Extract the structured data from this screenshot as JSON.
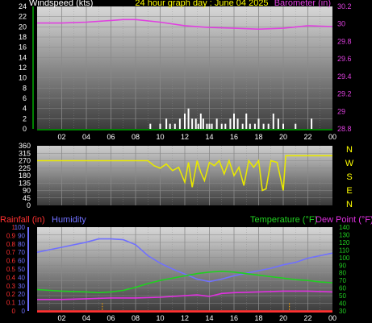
{
  "header": {
    "left_label": "Windspeed (kts)",
    "title": "24 hour graph day : June 04 2025",
    "right_label": "Barometer (in)"
  },
  "colors": {
    "bg_top": "#000000",
    "plot_bg_light": "#d8d8d8",
    "plot_bg_dark": "#3c3c3c",
    "pressure": "#e040e0",
    "wind_bars": "#ffffff",
    "wind_dir": "#e8e800",
    "humidity": "#7070ff",
    "temperature": "#20d020",
    "dewpoint": "#e030e0",
    "rain": "#ff3030",
    "title_yellow": "#ffff00",
    "axis_green": "#00ff00",
    "label_white": "#ffffff"
  },
  "time_axis": [
    "02",
    "04",
    "06",
    "08",
    "10",
    "12",
    "14",
    "16",
    "18",
    "20",
    "22",
    "00"
  ],
  "compass_labels": [
    "N",
    "W",
    "S",
    "E",
    "N"
  ],
  "panel3_labels": {
    "rain": "Rainfall (in)",
    "humidity": "Humidity",
    "temperature": "Temperature (°F)",
    "dewpoint": "Dew Point (°F)"
  },
  "chart_data": [
    {
      "type": "line",
      "title": "24 hour graph day : June 04 2025",
      "x_label": "",
      "ticks_x": [
        "02",
        "04",
        "06",
        "08",
        "10",
        "12",
        "14",
        "16",
        "18",
        "20",
        "22",
        "00"
      ],
      "left_axis": {
        "label": "Windspeed (kts)",
        "range": [
          0,
          24
        ],
        "ticks": [
          0,
          2,
          4,
          6,
          8,
          10,
          12,
          14,
          16,
          18,
          20,
          22,
          24
        ]
      },
      "right_axis": {
        "label": "Barometer (in)",
        "range": [
          28.8,
          30.2
        ],
        "ticks": [
          "28.8",
          "29",
          "29.2",
          "29.4",
          "29.6",
          "29.8",
          "30",
          "30.2"
        ]
      },
      "series": [
        {
          "name": "Barometer (in)",
          "axis": "right",
          "x": [
            0,
            2,
            4,
            6,
            7,
            8,
            10,
            12,
            14,
            16,
            18,
            20,
            22,
            24
          ],
          "y": [
            30.01,
            30.01,
            30.02,
            30.04,
            30.05,
            30.05,
            30.02,
            29.98,
            29.96,
            29.95,
            29.94,
            29.95,
            29.98,
            29.97
          ]
        },
        {
          "name": "Windspeed (kts)",
          "axis": "left",
          "kind": "bars",
          "x": [
            9.2,
            10.0,
            10.5,
            10.8,
            11.2,
            11.6,
            12.0,
            12.3,
            12.6,
            12.9,
            13.1,
            13.3,
            13.5,
            13.8,
            14.0,
            14.2,
            14.6,
            15.0,
            15.3,
            15.7,
            16.0,
            16.3,
            16.7,
            17.0,
            17.3,
            17.7,
            18.0,
            18.4,
            18.8,
            19.2,
            19.6,
            20.0,
            21.0,
            22.3
          ],
          "y": [
            1,
            1,
            2,
            1,
            1,
            2,
            3,
            4,
            2,
            2,
            1,
            3,
            2,
            1,
            1,
            1,
            2,
            1,
            1,
            2,
            3,
            2,
            1,
            3,
            1,
            1,
            2,
            1,
            1,
            3,
            2,
            1,
            1,
            2
          ]
        }
      ]
    },
    {
      "type": "line",
      "left_axis": {
        "range": [
          0,
          360
        ],
        "ticks": [
          0,
          45,
          90,
          135,
          180,
          225,
          270,
          315,
          360
        ]
      },
      "right_axis": {
        "labels": [
          "N",
          "W",
          "S",
          "E",
          "N"
        ]
      },
      "series": [
        {
          "name": "Wind direction",
          "axis": "left",
          "x": [
            0,
            9.0,
            9.5,
            10.0,
            10.5,
            11.0,
            11.5,
            12.0,
            12.3,
            12.6,
            13.0,
            13.3,
            13.6,
            14.0,
            14.4,
            14.8,
            15.2,
            15.6,
            16.0,
            16.4,
            16.8,
            17.2,
            17.6,
            18.0,
            18.3,
            18.6,
            19.0,
            19.5,
            20.0,
            20.2,
            24
          ],
          "y": [
            270,
            270,
            240,
            225,
            250,
            210,
            230,
            140,
            260,
            110,
            270,
            200,
            150,
            260,
            240,
            270,
            190,
            270,
            180,
            230,
            120,
            270,
            230,
            270,
            90,
            100,
            270,
            260,
            90,
            300,
            300
          ]
        }
      ]
    },
    {
      "type": "line",
      "ticks_x": [
        "02",
        "04",
        "06",
        "08",
        "10",
        "12",
        "14",
        "16",
        "18",
        "20",
        "22",
        "00"
      ],
      "left_axis": {
        "label": "Rainfall (in)",
        "range": [
          0,
          1
        ],
        "ticks": [
          "0",
          "0.1",
          "0.2",
          "0.3",
          "0.4",
          "0.5",
          "0.6",
          "0.7",
          "0.8",
          "0.9",
          "1"
        ]
      },
      "left_axis_2": {
        "label": "Humidity",
        "range": [
          0,
          100
        ],
        "ticks": [
          0,
          10,
          20,
          30,
          40,
          50,
          60,
          70,
          80,
          90,
          100
        ]
      },
      "right_axis": {
        "label": "Temperature (°F)",
        "range": [
          30,
          140
        ],
        "ticks": [
          30,
          40,
          50,
          60,
          70,
          80,
          90,
          100,
          110,
          120,
          130,
          140
        ]
      },
      "series": [
        {
          "name": "Humidity",
          "axis": "left_2",
          "x": [
            0,
            2,
            4,
            5,
            6,
            7,
            8,
            9,
            10,
            11,
            12,
            13,
            14,
            15,
            16,
            17,
            18,
            19,
            20,
            21,
            22,
            23,
            24
          ],
          "y": [
            70,
            76,
            82,
            86,
            86,
            85,
            79,
            66,
            57,
            50,
            44,
            38,
            35,
            38,
            42,
            45,
            48,
            51,
            55,
            58,
            63,
            66,
            69
          ]
        },
        {
          "name": "Temperature (°F)",
          "axis": "right",
          "x": [
            0,
            2,
            4,
            5,
            6,
            7,
            8,
            9,
            10,
            11,
            12,
            13,
            14,
            15,
            16,
            17,
            18,
            19,
            20,
            21,
            22,
            23,
            24
          ],
          "y": [
            58,
            56,
            55,
            54,
            55,
            57,
            61,
            66,
            70,
            73,
            76,
            79,
            81,
            82,
            81,
            79,
            77,
            75,
            73,
            71,
            70,
            68,
            67
          ]
        },
        {
          "name": "Dew Point (°F)",
          "axis": "right",
          "x": [
            0,
            2,
            4,
            6,
            8,
            10,
            12,
            13,
            14,
            15,
            16,
            18,
            20,
            22,
            24
          ],
          "y": [
            45,
            45,
            46,
            47,
            47,
            48,
            50,
            51,
            49,
            53,
            54,
            55,
            56,
            56,
            55
          ]
        },
        {
          "name": "Rainfall (in)",
          "axis": "left",
          "x": [
            0,
            24
          ],
          "y": [
            0,
            0
          ]
        }
      ]
    }
  ]
}
